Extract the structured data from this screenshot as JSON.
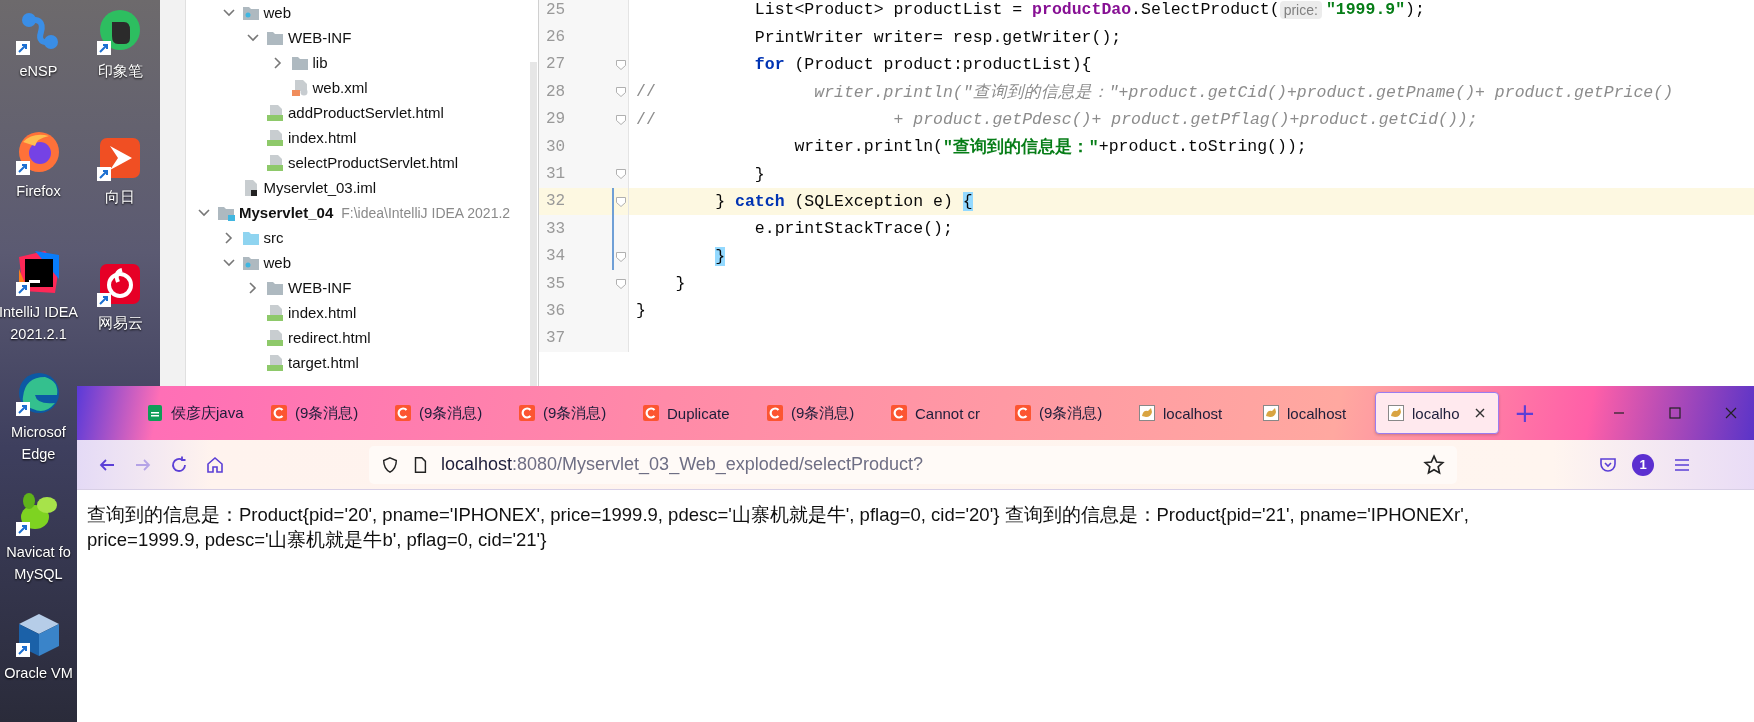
{
  "desktop_columns": [
    {
      "icons": [
        {
          "kind": "ensp",
          "lines": [
            "eNSP"
          ]
        },
        {
          "kind": "firefox",
          "lines": [
            "Firefox"
          ]
        },
        {
          "kind": "intellij",
          "lines": [
            "IntelliJ IDEA",
            "2021.2.1"
          ]
        },
        {
          "kind": "edge",
          "lines": [
            "Microsof",
            "Edge"
          ]
        },
        {
          "kind": "navicat",
          "lines": [
            "Navicat fo",
            "MySQL"
          ]
        },
        {
          "kind": "virtualbox",
          "lines": [
            "Oracle VM"
          ]
        }
      ]
    },
    {
      "icons": [
        {
          "kind": "evernote",
          "lines": [
            "印象笔"
          ]
        },
        {
          "kind": "sunflower",
          "lines": [
            "向日"
          ]
        },
        {
          "kind": "netease",
          "lines": [
            "网易云"
          ]
        }
      ]
    }
  ],
  "project_tree": {
    "continued_children": [
      {
        "label": "web",
        "kind": "web-folder",
        "expanded": true,
        "children": [
          {
            "label": "WEB-INF",
            "kind": "folder",
            "expanded": true,
            "children": [
              {
                "label": "lib",
                "kind": "folder",
                "expanded": false
              },
              {
                "label": "web.xml",
                "kind": "xml"
              }
            ]
          },
          {
            "label": "addProductServlet.html",
            "kind": "html"
          },
          {
            "label": "index.html",
            "kind": "html"
          },
          {
            "label": "selectProductServlet.html",
            "kind": "html"
          }
        ]
      },
      {
        "label": "Myservlet_03.iml",
        "kind": "iml"
      }
    ],
    "roots": [
      {
        "label": "Myservlet_04",
        "path": "F:\\idea\\IntelliJ IDEA 2021.2",
        "kind": "module",
        "expanded": true,
        "children": [
          {
            "label": "src",
            "kind": "source-folder",
            "expanded": false
          },
          {
            "label": "web",
            "kind": "web-folder",
            "expanded": true,
            "children": [
              {
                "label": "WEB-INF",
                "kind": "folder",
                "expanded": false
              },
              {
                "label": "index.html",
                "kind": "html"
              },
              {
                "label": "redirect.html",
                "kind": "html"
              },
              {
                "label": "target.html",
                "kind": "html"
              }
            ]
          }
        ]
      }
    ]
  },
  "code_lines": [
    {
      "number": "25",
      "fold": false,
      "current": false,
      "changed": false,
      "tokens": [
        {
          "kind": "plain",
          "text": "            List<Product> productList = "
        },
        {
          "kind": "field",
          "text": "productDao"
        },
        {
          "kind": "plain",
          "text": ".SelectProduct("
        },
        {
          "kind": "hint",
          "text": "price:"
        },
        {
          "kind": "string",
          "text": "\"1999.9\""
        },
        {
          "kind": "plain",
          "text": ");"
        }
      ]
    },
    {
      "number": "26",
      "fold": false,
      "current": false,
      "changed": false,
      "tokens": [
        {
          "kind": "plain",
          "text": "            PrintWriter writer= resp.getWriter();"
        }
      ]
    },
    {
      "number": "27",
      "fold": true,
      "current": false,
      "changed": false,
      "tokens": [
        {
          "kind": "keyword",
          "text": "            for"
        },
        {
          "kind": "plain",
          "text": " (Product product:productList){"
        }
      ]
    },
    {
      "number": "28",
      "fold": true,
      "current": false,
      "changed": false,
      "tokens": [
        {
          "kind": "comment-mark",
          "text": "//"
        },
        {
          "kind": "comment",
          "text": "                writer.println(\"查询到的信息是：\"+product.getCid()+product.getPname()+ product.getPrice()"
        }
      ]
    },
    {
      "number": "29",
      "fold": true,
      "current": false,
      "changed": false,
      "tokens": [
        {
          "kind": "comment-mark",
          "text": "//"
        },
        {
          "kind": "comment",
          "text": "                        + product.getPdesc()+ product.getPflag()+product.getCid());"
        }
      ]
    },
    {
      "number": "30",
      "fold": false,
      "current": false,
      "changed": false,
      "tokens": [
        {
          "kind": "plain",
          "text": "                writer.println("
        },
        {
          "kind": "string",
          "text": "\"查询到的信息是：\""
        },
        {
          "kind": "plain",
          "text": "+product.toString());"
        }
      ]
    },
    {
      "number": "31",
      "fold": true,
      "current": false,
      "changed": false,
      "tokens": [
        {
          "kind": "plain",
          "text": "            }"
        }
      ]
    },
    {
      "number": "32",
      "fold": true,
      "current": true,
      "changed": true,
      "tokens": [
        {
          "kind": "plain",
          "text": "        } "
        },
        {
          "kind": "keyword",
          "text": "catch"
        },
        {
          "kind": "plain",
          "text": " (SQLException e) "
        },
        {
          "kind": "brace",
          "text": "{"
        }
      ]
    },
    {
      "number": "33",
      "fold": false,
      "current": false,
      "changed": true,
      "tokens": [
        {
          "kind": "plain",
          "text": "            e.printStackTrace();"
        }
      ]
    },
    {
      "number": "34",
      "fold": true,
      "current": false,
      "changed": true,
      "tokens": [
        {
          "kind": "brace",
          "text": "        }"
        }
      ]
    },
    {
      "number": "35",
      "fold": true,
      "current": false,
      "changed": false,
      "tokens": [
        {
          "kind": "plain",
          "text": "    }"
        }
      ]
    },
    {
      "number": "36",
      "fold": false,
      "current": false,
      "changed": false,
      "tokens": [
        {
          "kind": "plain",
          "text": "}"
        }
      ]
    },
    {
      "number": "37",
      "fold": false,
      "current": false,
      "changed": false
    }
  ],
  "browser": {
    "tabs": [
      {
        "title": "侯彦庆java",
        "kind": "sheet",
        "selected": false
      },
      {
        "title": "(9条消息)",
        "kind": "csdn",
        "selected": false
      },
      {
        "title": "(9条消息)",
        "kind": "csdn",
        "selected": false
      },
      {
        "title": "(9条消息)",
        "kind": "csdn",
        "selected": false
      },
      {
        "title": "Duplicate",
        "kind": "csdn",
        "selected": false
      },
      {
        "title": "(9条消息)",
        "kind": "csdn",
        "selected": false
      },
      {
        "title": "Cannot cr",
        "kind": "csdn",
        "selected": false
      },
      {
        "title": "(9条消息)",
        "kind": "csdn",
        "selected": false
      },
      {
        "title": "localhost",
        "kind": "tomcat",
        "selected": false
      },
      {
        "title": "localhost",
        "kind": "tomcat",
        "selected": false
      },
      {
        "title": "localho",
        "kind": "tomcat",
        "selected": true
      }
    ],
    "new_tab": "+",
    "nav": {
      "forward_disabled": true
    },
    "url": {
      "host": "localhost",
      "rest": ":8080/Myservlet_03_Web_exploded/selectProduct?"
    },
    "account_badge": "1",
    "page_text": "查询到的信息是：Product{pid='20', pname='IPHONEX', price=1999.9, pdesc='山寨机就是牛', pflag=0, cid='20'} 查询到的信息是：Product{pid='21', pname='IPHONEXr', price=1999.9, pdesc='山寨机就是牛b', pflag=0, cid='21'}"
  }
}
